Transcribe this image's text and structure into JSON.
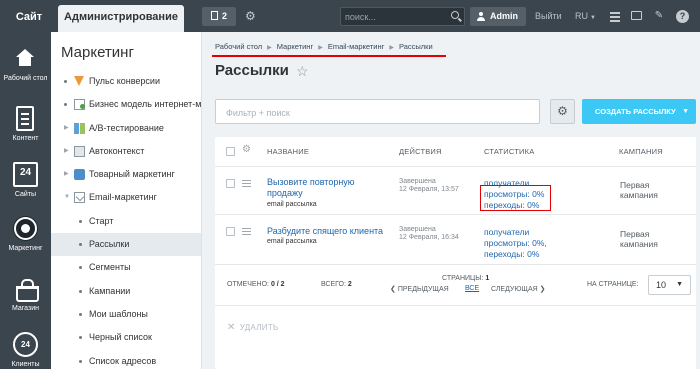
{
  "topbar": {
    "site": "Сайт",
    "admin": "Администрирование",
    "notif_count": "2",
    "search_placeholder": "поиск...",
    "user": "Admin",
    "logout": "Выйти",
    "lang": "RU"
  },
  "rail": {
    "items": [
      {
        "label": "Рабочий стол",
        "icon": "home-icon"
      },
      {
        "label": "Контент",
        "icon": "document-icon"
      },
      {
        "label": "Сайты",
        "icon": "calendar-icon",
        "icon_text": "24"
      },
      {
        "label": "Маркетинг",
        "icon": "target-icon",
        "active": true
      },
      {
        "label": "Магазин",
        "icon": "basket-icon"
      },
      {
        "label": "Клиенты",
        "icon": "clients-icon",
        "icon_text": "24"
      }
    ]
  },
  "menu": {
    "title": "Маркетинг",
    "items": [
      {
        "label": "Пульс конверсии"
      },
      {
        "label": "Бизнес модель интернет-маг"
      },
      {
        "label": "A/B-тестирование"
      },
      {
        "label": "Автоконтекст"
      },
      {
        "label": "Товарный маркетинг"
      },
      {
        "label": "Email-маркетинг"
      },
      {
        "label": "Старт"
      },
      {
        "label": "Рассылки",
        "selected": true
      },
      {
        "label": "Сегменты"
      },
      {
        "label": "Кампании"
      },
      {
        "label": "Мои шаблоны"
      },
      {
        "label": "Черный список"
      },
      {
        "label": "Список адресов"
      }
    ]
  },
  "breadcrumbs": [
    "Рабочий стол",
    "Маркетинг",
    "Email-маркетинг",
    "Рассылки"
  ],
  "page_title": "Рассылки",
  "filter_placeholder": "Фильтр + поиск",
  "create_button": "СОЗДАТЬ РАССЫЛКУ",
  "grid": {
    "columns": [
      "НАЗВАНИЕ",
      "ДЕЙСТВИЯ",
      "СТАТИСТИКА",
      "КАМПАНИЯ"
    ],
    "rows": [
      {
        "name_line1": "Вызовите повторную",
        "name_line2": "продажу",
        "type": "email рассылка",
        "status": "Завершена",
        "date": "12 Февраля, 13:57",
        "stat_recipients": "получатели",
        "stat_views": "просмотры: 0%",
        "stat_clicks": "переходы: 0%",
        "campaign_line1": "Первая",
        "campaign_line2": "кампания"
      },
      {
        "name_line1": "Разбудите спящего клиента",
        "type": "email рассылка",
        "status": "Завершена",
        "date": "12 Февраля, 16:34",
        "stat_recipients": "получатели",
        "stat_views": "просмотры: 0%,",
        "stat_clicks": "переходы: 0%",
        "campaign_line1": "Первая",
        "campaign_line2": "кампания"
      }
    ],
    "footer": {
      "marked_label": "ОТМЕЧЕНО:",
      "marked_value": "0 / 2",
      "total_label": "ВСЕГО:",
      "total_value": "2",
      "pages_label": "СТРАНИЦЫ:",
      "pages_value": "1",
      "prev": "ПРЕДЫДУЩАЯ",
      "all": "ВСЕ",
      "next": "СЛЕДУЮЩАЯ",
      "per_page_label": "НА СТРАНИЦЕ:",
      "per_page_value": "10"
    },
    "delete": "УДАЛИТЬ"
  }
}
